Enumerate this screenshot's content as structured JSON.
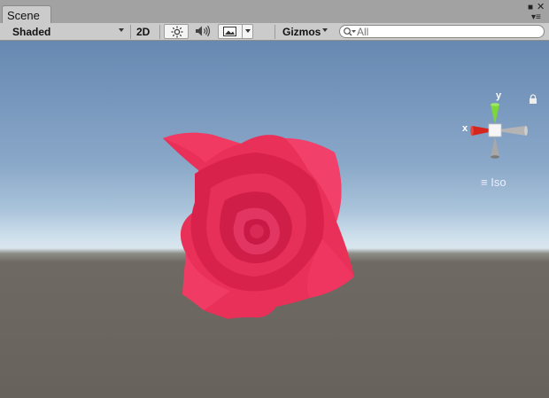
{
  "tab": {
    "label": "Scene"
  },
  "toolbar": {
    "shading_mode": "Shaded",
    "mode_2d": "2D",
    "gizmos_label": "Gizmos",
    "search_placeholder": "All"
  },
  "gizmo": {
    "x_label": "x",
    "y_label": "y",
    "projection_label": "Iso"
  },
  "colors": {
    "rose": "#ea2a5a",
    "x_axis": "#d4261e",
    "y_axis": "#7dd63a",
    "toolbar_bg": "#cbcbcb"
  },
  "icons": {
    "lighting": "sun-icon",
    "audio": "speaker-icon",
    "effects": "image-icon",
    "search": "search-icon",
    "lock": "lock-icon",
    "menu": "hamburger-icon"
  }
}
